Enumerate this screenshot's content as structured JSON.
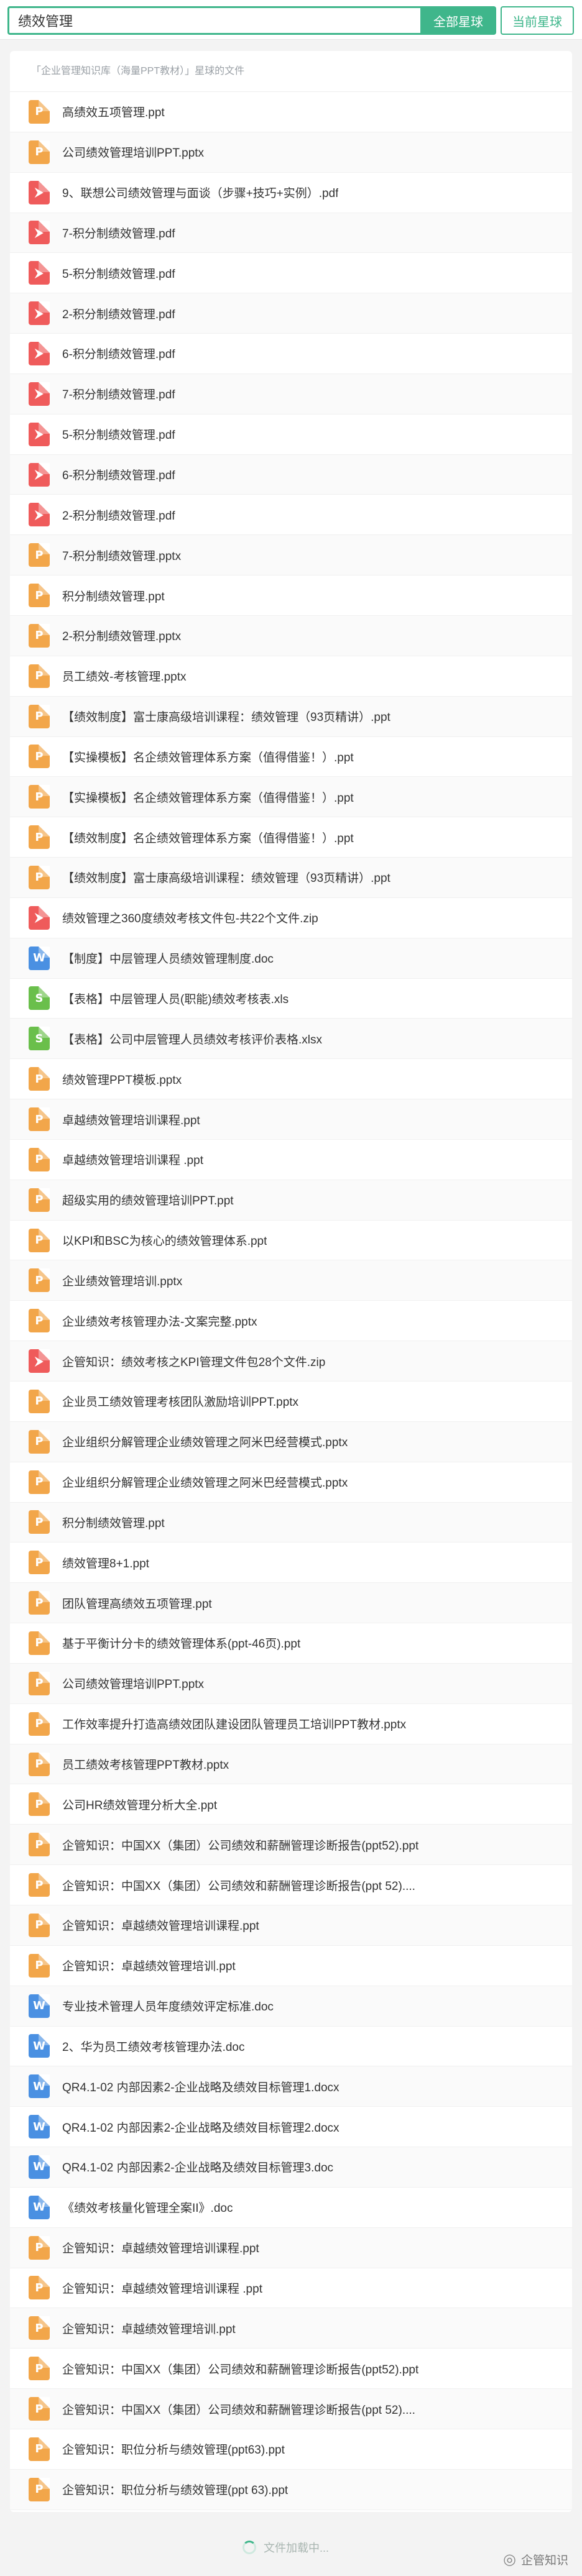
{
  "search": {
    "query": "绩效管理",
    "all_button": "全部星球",
    "current_button": "当前星球"
  },
  "results": {
    "header": "「企业管理知识库（海量PPT教材）」星球的文件",
    "items": [
      {
        "name": "高绩效五项管理.ppt",
        "type": "ppt",
        "icon": "ppt-file-icon"
      },
      {
        "name": "公司绩效管理培训PPT.pptx",
        "type": "ppt",
        "icon": "ppt-file-icon"
      },
      {
        "name": "9、联想公司绩效管理与面谈（步骤+技巧+实例）.pdf",
        "type": "pdf",
        "icon": "pdf-file-icon"
      },
      {
        "name": "7-积分制绩效管理.pdf",
        "type": "pdf",
        "icon": "pdf-file-icon"
      },
      {
        "name": "5-积分制绩效管理.pdf",
        "type": "pdf",
        "icon": "pdf-file-icon"
      },
      {
        "name": "2-积分制绩效管理.pdf",
        "type": "pdf",
        "icon": "pdf-file-icon"
      },
      {
        "name": "6-积分制绩效管理.pdf",
        "type": "pdf",
        "icon": "pdf-file-icon"
      },
      {
        "name": "7-积分制绩效管理.pdf",
        "type": "pdf",
        "icon": "pdf-file-icon"
      },
      {
        "name": "5-积分制绩效管理.pdf",
        "type": "pdf",
        "icon": "pdf-file-icon"
      },
      {
        "name": "6-积分制绩效管理.pdf",
        "type": "pdf",
        "icon": "pdf-file-icon"
      },
      {
        "name": "2-积分制绩效管理.pdf",
        "type": "pdf",
        "icon": "pdf-file-icon"
      },
      {
        "name": "7-积分制绩效管理.pptx",
        "type": "ppt",
        "icon": "ppt-file-icon"
      },
      {
        "name": "积分制绩效管理.ppt",
        "type": "ppt",
        "icon": "ppt-file-icon"
      },
      {
        "name": "2-积分制绩效管理.pptx",
        "type": "ppt",
        "icon": "ppt-file-icon"
      },
      {
        "name": "员工绩效-考核管理.pptx",
        "type": "ppt",
        "icon": "ppt-file-icon"
      },
      {
        "name": "【绩效制度】富士康高级培训课程：绩效管理（93页精讲）.ppt",
        "type": "ppt",
        "icon": "ppt-file-icon"
      },
      {
        "name": "【实操模板】名企绩效管理体系方案（值得借鉴！）.ppt",
        "type": "ppt",
        "icon": "ppt-file-icon"
      },
      {
        "name": "【实操模板】名企绩效管理体系方案（值得借鉴！）.ppt",
        "type": "ppt",
        "icon": "ppt-file-icon"
      },
      {
        "name": "【绩效制度】名企绩效管理体系方案（值得借鉴！）.ppt",
        "type": "ppt",
        "icon": "ppt-file-icon"
      },
      {
        "name": "【绩效制度】富士康高级培训课程：绩效管理（93页精讲）.ppt",
        "type": "ppt",
        "icon": "ppt-file-icon"
      },
      {
        "name": "绩效管理之360度绩效考核文件包-共22个文件.zip",
        "type": "zip",
        "icon": "zip-file-icon"
      },
      {
        "name": "【制度】中层管理人员绩效管理制度.doc",
        "type": "doc",
        "icon": "word-file-icon"
      },
      {
        "name": "【表格】中层管理人员(职能)绩效考核表.xls",
        "type": "xls",
        "icon": "excel-file-icon"
      },
      {
        "name": "【表格】公司中层管理人员绩效考核评价表格.xlsx",
        "type": "xls",
        "icon": "excel-file-icon"
      },
      {
        "name": "绩效管理PPT模板.pptx",
        "type": "ppt",
        "icon": "ppt-file-icon"
      },
      {
        "name": "卓越绩效管理培训课程.ppt",
        "type": "ppt",
        "icon": "ppt-file-icon"
      },
      {
        "name": "卓越绩效管理培训课程 .ppt",
        "type": "ppt",
        "icon": "ppt-file-icon"
      },
      {
        "name": "超级实用的绩效管理培训PPT.ppt",
        "type": "ppt",
        "icon": "ppt-file-icon"
      },
      {
        "name": "以KPI和BSC为核心的绩效管理体系.ppt",
        "type": "ppt",
        "icon": "ppt-file-icon"
      },
      {
        "name": "企业绩效管理培训.pptx",
        "type": "ppt",
        "icon": "ppt-file-icon"
      },
      {
        "name": "企业绩效考核管理办法-文案完整.pptx",
        "type": "ppt",
        "icon": "ppt-file-icon"
      },
      {
        "name": "企管知识：绩效考核之KPI管理文件包28个文件.zip",
        "type": "zip",
        "icon": "zip-file-icon"
      },
      {
        "name": "企业员工绩效管理考核团队激励培训PPT.pptx",
        "type": "ppt",
        "icon": "ppt-file-icon"
      },
      {
        "name": "企业组织分解管理企业绩效管理之阿米巴经营模式.pptx",
        "type": "ppt",
        "icon": "ppt-file-icon"
      },
      {
        "name": "企业组织分解管理企业绩效管理之阿米巴经营模式.pptx",
        "type": "ppt",
        "icon": "ppt-file-icon"
      },
      {
        "name": "积分制绩效管理.ppt",
        "type": "ppt",
        "icon": "ppt-file-icon"
      },
      {
        "name": "绩效管理8+1.ppt",
        "type": "ppt",
        "icon": "ppt-file-icon"
      },
      {
        "name": "团队管理高绩效五项管理.ppt",
        "type": "ppt",
        "icon": "ppt-file-icon"
      },
      {
        "name": "基于平衡计分卡的绩效管理体系(ppt-46页).ppt",
        "type": "ppt",
        "icon": "ppt-file-icon"
      },
      {
        "name": "公司绩效管理培训PPT.pptx",
        "type": "ppt",
        "icon": "ppt-file-icon"
      },
      {
        "name": "工作效率提升打造高绩效团队建设团队管理员工培训PPT教材.pptx",
        "type": "ppt",
        "icon": "ppt-file-icon"
      },
      {
        "name": "员工绩效考核管理PPT教材.pptx",
        "type": "ppt",
        "icon": "ppt-file-icon"
      },
      {
        "name": "公司HR绩效管理分析大全.ppt",
        "type": "ppt",
        "icon": "ppt-file-icon"
      },
      {
        "name": "企管知识：中国XX（集团）公司绩效和薪酬管理诊断报告(ppt52).ppt",
        "type": "ppt",
        "icon": "ppt-file-icon"
      },
      {
        "name": "企管知识：中国XX（集团）公司绩效和薪酬管理诊断报告(ppt 52)....",
        "type": "ppt",
        "icon": "ppt-file-icon"
      },
      {
        "name": "企管知识：卓越绩效管理培训课程.ppt",
        "type": "ppt",
        "icon": "ppt-file-icon"
      },
      {
        "name": "企管知识：卓越绩效管理培训.ppt",
        "type": "ppt",
        "icon": "ppt-file-icon"
      },
      {
        "name": "专业技术管理人员年度绩效评定标准.doc",
        "type": "doc",
        "icon": "word-file-icon"
      },
      {
        "name": "2、华为员工绩效考核管理办法.doc",
        "type": "doc",
        "icon": "word-file-icon"
      },
      {
        "name": "QR4.1-02 内部因素2-企业战略及绩效目标管理1.docx",
        "type": "doc",
        "icon": "word-file-icon"
      },
      {
        "name": "QR4.1-02 内部因素2-企业战略及绩效目标管理2.docx",
        "type": "doc",
        "icon": "word-file-icon"
      },
      {
        "name": "QR4.1-02 内部因素2-企业战略及绩效目标管理3.doc",
        "type": "doc",
        "icon": "word-file-icon"
      },
      {
        "name": "《绩效考核量化管理全案II》.doc",
        "type": "doc",
        "icon": "word-file-icon"
      },
      {
        "name": "企管知识：卓越绩效管理培训课程.ppt",
        "type": "ppt",
        "icon": "ppt-file-icon"
      },
      {
        "name": "企管知识：卓越绩效管理培训课程 .ppt",
        "type": "ppt",
        "icon": "ppt-file-icon"
      },
      {
        "name": "企管知识：卓越绩效管理培训.ppt",
        "type": "ppt",
        "icon": "ppt-file-icon"
      },
      {
        "name": "企管知识：中国XX（集团）公司绩效和薪酬管理诊断报告(ppt52).ppt",
        "type": "ppt",
        "icon": "ppt-file-icon"
      },
      {
        "name": "企管知识：中国XX（集团）公司绩效和薪酬管理诊断报告(ppt 52)....",
        "type": "ppt",
        "icon": "ppt-file-icon"
      },
      {
        "name": "企管知识：职位分析与绩效管理(ppt63).ppt",
        "type": "ppt",
        "icon": "ppt-file-icon"
      },
      {
        "name": "企管知识：职位分析与绩效管理(ppt 63).ppt",
        "type": "ppt",
        "icon": "ppt-file-icon"
      }
    ]
  },
  "footer": {
    "loading_text": "文件加载中...",
    "brand": "企管知识",
    "brand_icon": "wechat-icon"
  },
  "colors": {
    "accent": "#3fb68b",
    "ppt": "#f2a64a",
    "pdf": "#ef5b5b",
    "doc": "#4a90e2",
    "xls": "#6abf4b"
  }
}
